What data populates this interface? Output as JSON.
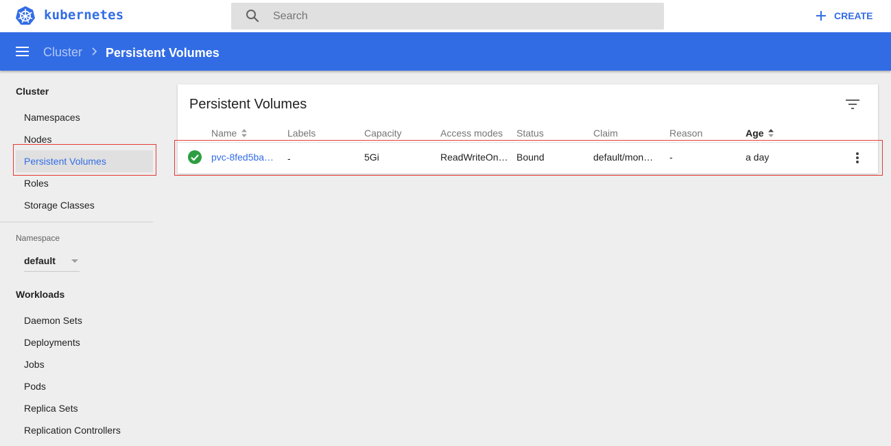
{
  "app": {
    "brand": "kubernetes",
    "icons": {
      "logo": "kubernetes-helm-icon",
      "search": "search-icon",
      "create": "plus-icon",
      "menu": "hamburger-icon",
      "filter": "filter-icon",
      "more": "more-vert-icon",
      "status": "check-circle-icon"
    },
    "colors": {
      "accent": "#326ce5",
      "status_ok": "#2e9e42",
      "highlight": "#e53935"
    }
  },
  "search": {
    "placeholder": "Search",
    "value": ""
  },
  "header": {
    "create_label": "CREATE"
  },
  "breadcrumb": {
    "parent": "Cluster",
    "current": "Persistent Volumes"
  },
  "sidebar": {
    "cluster_heading": "Cluster",
    "cluster_items": [
      {
        "label": "Namespaces",
        "active": false
      },
      {
        "label": "Nodes",
        "active": false
      },
      {
        "label": "Persistent Volumes",
        "active": true
      },
      {
        "label": "Roles",
        "active": false
      },
      {
        "label": "Storage Classes",
        "active": false
      }
    ],
    "namespace_label": "Namespace",
    "namespace_value": "default",
    "workloads_heading": "Workloads",
    "workload_items": [
      {
        "label": "Daemon Sets"
      },
      {
        "label": "Deployments"
      },
      {
        "label": "Jobs"
      },
      {
        "label": "Pods"
      },
      {
        "label": "Replica Sets"
      },
      {
        "label": "Replication Controllers"
      }
    ]
  },
  "card": {
    "title": "Persistent Volumes",
    "columns": [
      "Name",
      "Labels",
      "Capacity",
      "Access modes",
      "Status",
      "Claim",
      "Reason",
      "Age"
    ],
    "sort": {
      "sortable_columns": [
        "Name",
        "Age"
      ],
      "active_column": "Age"
    },
    "rows": [
      {
        "status": "ok",
        "name": "pvc-8fed5ba…",
        "labels": "-",
        "capacity": "5Gi",
        "access_modes": "ReadWriteOn…",
        "status_text": "Bound",
        "claim": "default/mon…",
        "reason": "-",
        "age": "a day"
      }
    ]
  }
}
